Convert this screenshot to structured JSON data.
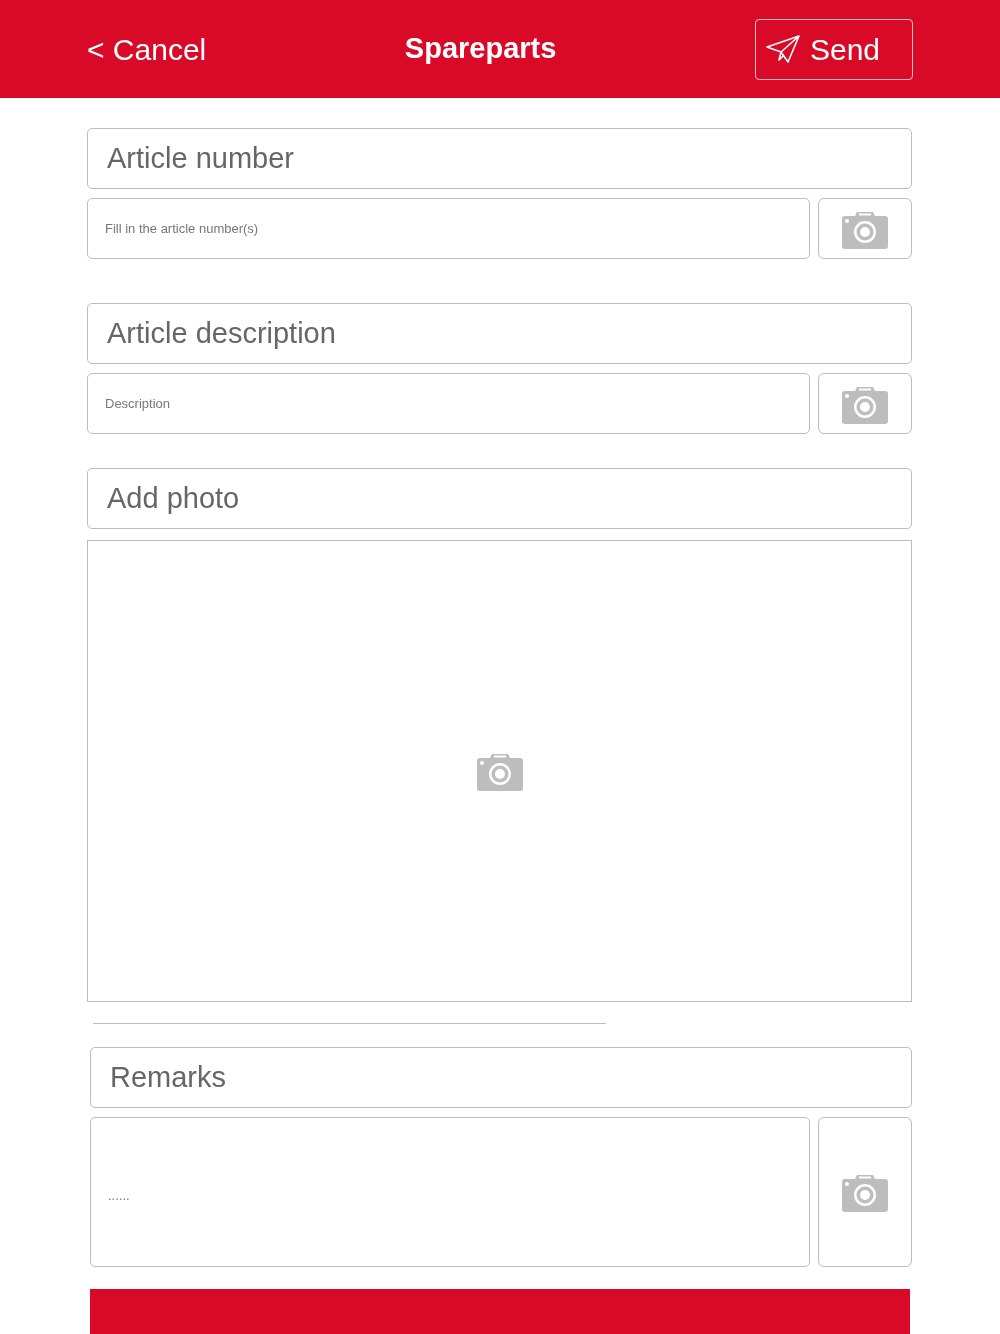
{
  "header": {
    "cancel": "< Cancel",
    "title": "Spareparts",
    "send": "Send"
  },
  "sections": [
    {
      "kind": "field",
      "label": "Article number",
      "placeholder": "Fill in the article number(s)"
    },
    {
      "kind": "field",
      "label": "Article description",
      "placeholder": "Description"
    },
    {
      "kind": "photo",
      "label": "Add photo"
    },
    {
      "kind": "textarea",
      "label": "Remarks",
      "placeholder": "......"
    }
  ]
}
